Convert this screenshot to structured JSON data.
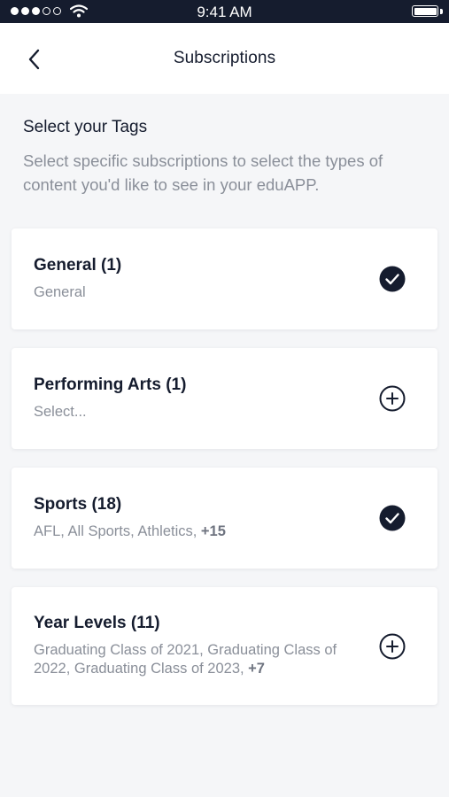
{
  "status_bar": {
    "time": "9:41 AM",
    "signal_dots_filled": 3,
    "signal_dots_total": 5,
    "battery_level": 1.0
  },
  "header": {
    "title": "Subscriptions",
    "back_icon": "chevron-left-icon"
  },
  "intro": {
    "title": "Select your Tags",
    "description": "Select specific subscriptions to select the types of content you'd like to see in your eduAPP."
  },
  "cards": [
    {
      "title": "General (1)",
      "subtitle": "General",
      "extra": "",
      "selected": true,
      "icon": "check-circle-icon"
    },
    {
      "title": "Performing Arts (1)",
      "subtitle": "Select...",
      "extra": "",
      "selected": false,
      "icon": "plus-circle-icon"
    },
    {
      "title": "Sports (18)",
      "subtitle": "AFL, All Sports, Athletics,",
      "extra": "+15",
      "selected": true,
      "icon": "check-circle-icon"
    },
    {
      "title": "Year Levels (11)",
      "subtitle": "Graduating Class of 2021, Graduating Class of 2022, Graduating Class of 2023,",
      "extra": "+7",
      "selected": false,
      "icon": "plus-circle-icon"
    }
  ],
  "colors": {
    "primary": "#151c2e",
    "background": "#f5f6f8",
    "muted_text": "#8a8f99"
  }
}
